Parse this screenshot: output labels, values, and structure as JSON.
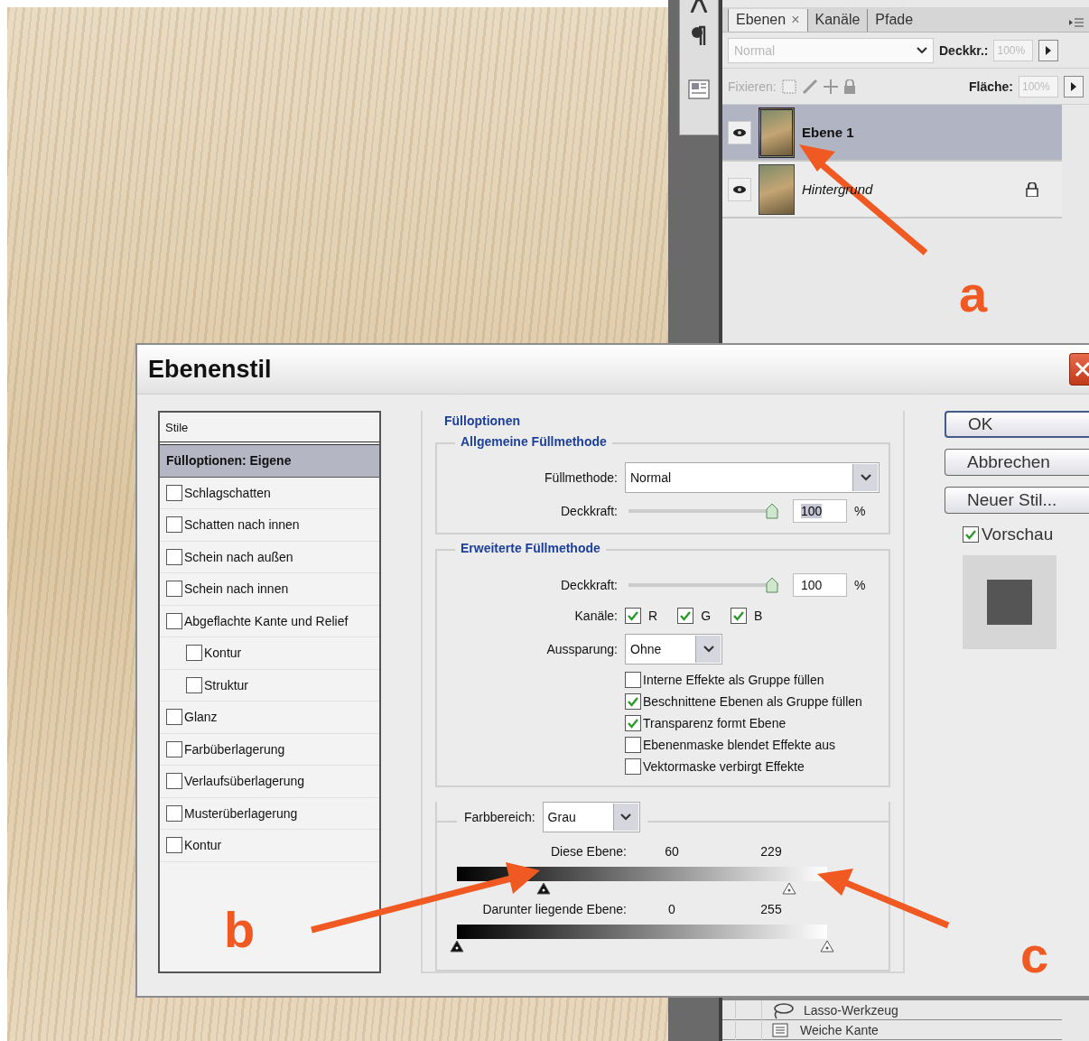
{
  "layers_panel": {
    "tabs": [
      {
        "label": "Ebenen",
        "close": "×",
        "selected": true
      },
      {
        "label": "Kanäle",
        "selected": false
      },
      {
        "label": "Pfade",
        "selected": false
      }
    ],
    "blend_mode": {
      "value": "Normal",
      "disabled": true
    },
    "opacity": {
      "label": "Deckkr.:",
      "value": "100%",
      "disabled": true
    },
    "lock": {
      "label": "Fixieren:",
      "disabled": true
    },
    "fill": {
      "label": "Fläche:",
      "value": "100%",
      "disabled": true
    },
    "layers": [
      {
        "name": "Ebene 1",
        "selected": true,
        "visible": true,
        "locked": false,
        "italic": false
      },
      {
        "name": "Hintergrund",
        "selected": false,
        "visible": true,
        "locked": true,
        "italic": true
      }
    ]
  },
  "history_panel": {
    "items": [
      {
        "label": "Lasso-Werkzeug",
        "kind": "lasso"
      },
      {
        "label": "Weiche Kante",
        "kind": "feather"
      }
    ]
  },
  "dialog": {
    "title": "Ebenenstil",
    "styles_header": "Stile",
    "styles": [
      {
        "label": "Fülloptionen: Eigene",
        "kind": "header",
        "selected": true
      },
      {
        "label": "Schlagschatten",
        "kind": "check",
        "checked": false,
        "selected": false
      },
      {
        "label": "Schatten nach innen",
        "kind": "check",
        "checked": false,
        "selected": false
      },
      {
        "label": "Schein nach außen",
        "kind": "check",
        "checked": false,
        "selected": false
      },
      {
        "label": "Schein nach innen",
        "kind": "check",
        "checked": false,
        "selected": false
      },
      {
        "label": "Abgeflachte Kante und Relief",
        "kind": "check",
        "checked": false,
        "selected": false,
        "children": [
          {
            "label": "Kontur",
            "kind": "check",
            "checked": false,
            "selected": false
          },
          {
            "label": "Struktur",
            "kind": "check",
            "checked": false,
            "selected": false
          }
        ]
      },
      {
        "label": "Glanz",
        "kind": "check",
        "checked": false,
        "selected": false
      },
      {
        "label": "Farbüberlagerung",
        "kind": "check",
        "checked": false,
        "selected": false
      },
      {
        "label": "Verlaufsüberlagerung",
        "kind": "check",
        "checked": false,
        "selected": false
      },
      {
        "label": "Musterüberlagerung",
        "kind": "check",
        "checked": false,
        "selected": false
      },
      {
        "label": "Kontur",
        "kind": "check",
        "checked": false,
        "selected": false
      }
    ],
    "fill_options": {
      "title": "Fülloptionen",
      "general": {
        "title": "Allgemeine Füllmethode",
        "blend_mode": {
          "label": "Füllmethode:",
          "value": "Normal"
        },
        "opacity": {
          "label": "Deckkraft:",
          "level": 1,
          "value": "100",
          "unit": "%",
          "focused": true
        }
      },
      "advanced": {
        "title": "Erweiterte Füllmethode",
        "opacity": {
          "label": "Deckkraft:",
          "level": 1,
          "value": "100",
          "unit": "%",
          "focused": false
        },
        "channels": {
          "label": "Kanäle:",
          "items": [
            {
              "label": "R",
              "checked": true
            },
            {
              "label": "G",
              "checked": true
            },
            {
              "label": "B",
              "checked": true
            }
          ]
        },
        "knockout": {
          "label": "Aussparung:",
          "value": "Ohne"
        },
        "options": [
          {
            "label": "Interne Effekte als Gruppe füllen",
            "checked": false
          },
          {
            "label": "Beschnittene Ebenen als Gruppe füllen",
            "checked": true
          },
          {
            "label": "Transparenz formt Ebene",
            "checked": true
          },
          {
            "label": "Ebenenmaske blendet Effekte aus",
            "checked": false
          },
          {
            "label": "Vektormaske verbirgt Effekte",
            "checked": false
          }
        ]
      },
      "blend_if": {
        "label": "Farbbereich:",
        "value": "Grau",
        "ranges": [
          {
            "label": "Diese Ebene:",
            "thumbs": [
              {
                "value": "60",
                "level": 0.235
              },
              {
                "value": "229",
                "level": 0.898
              }
            ]
          },
          {
            "label": "Darunter liegende Ebene:",
            "thumbs": [
              {
                "value": "0",
                "level": 0
              },
              {
                "value": "255",
                "level": 1
              }
            ]
          }
        ]
      }
    },
    "buttons": [
      {
        "label": "OK",
        "default": true
      },
      {
        "label": "Abbrechen",
        "default": false
      },
      {
        "label": "Neuer Stil...",
        "default": false
      }
    ],
    "preview": {
      "label": "Vorschau",
      "checked": true
    }
  },
  "annotations": [
    {
      "letter": "a"
    },
    {
      "letter": "b"
    },
    {
      "letter": "c"
    }
  ]
}
